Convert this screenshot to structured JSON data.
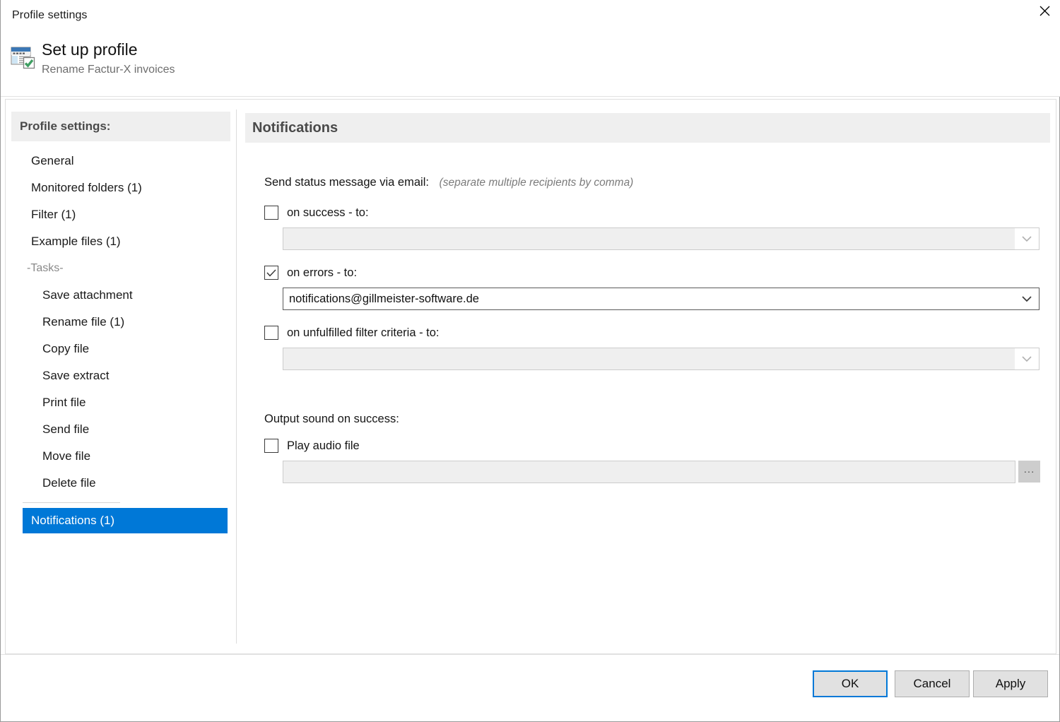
{
  "window": {
    "title": "Profile settings",
    "close_icon": "close-icon"
  },
  "header": {
    "icon": "profile-setup-icon",
    "title": "Set up profile",
    "subtitle": "Rename Factur-X invoices"
  },
  "sidebar": {
    "heading": "Profile settings:",
    "items": [
      {
        "label": "General",
        "kind": "item",
        "selected": false
      },
      {
        "label": "Monitored folders (1)",
        "kind": "item",
        "selected": false
      },
      {
        "label": "Filter (1)",
        "kind": "item",
        "selected": false
      },
      {
        "label": "Example files (1)",
        "kind": "item",
        "selected": false
      },
      {
        "label": "-Tasks-",
        "kind": "section",
        "selected": false
      },
      {
        "label": "Save attachment",
        "kind": "task",
        "selected": false
      },
      {
        "label": "Rename file (1)",
        "kind": "task",
        "selected": false
      },
      {
        "label": "Copy file",
        "kind": "task",
        "selected": false
      },
      {
        "label": "Save extract",
        "kind": "task",
        "selected": false
      },
      {
        "label": "Print file",
        "kind": "task",
        "selected": false
      },
      {
        "label": "Send file",
        "kind": "task",
        "selected": false
      },
      {
        "label": "Move file",
        "kind": "task",
        "selected": false
      },
      {
        "label": "Delete file",
        "kind": "task",
        "selected": false
      },
      {
        "label": "Notifications (1)",
        "kind": "item",
        "selected": true
      }
    ]
  },
  "main": {
    "section_title": "Notifications",
    "email_group": {
      "label": "Send status message via email:",
      "hint": "(separate multiple recipients by comma)",
      "rows": [
        {
          "checkbox_label": "on success - to:",
          "checked": false,
          "value": "",
          "placeholder": "",
          "enabled": false
        },
        {
          "checkbox_label": "on errors - to:",
          "checked": true,
          "value": "notifications@gillmeister-software.de",
          "placeholder": "",
          "enabled": true
        },
        {
          "checkbox_label": "on unfulfilled filter criteria - to:",
          "checked": false,
          "value": "",
          "placeholder": "",
          "enabled": false
        }
      ]
    },
    "sound_group": {
      "label": "Output sound on success:",
      "checkbox_label": "Play audio file",
      "checked": false,
      "value": "",
      "placeholder": "",
      "browse_label": "..."
    }
  },
  "footer": {
    "ok_label": "OK",
    "cancel_label": "Cancel",
    "apply_label": "Apply"
  },
  "colors": {
    "accent": "#0078d7",
    "header_band": "#efefef",
    "disabled_field": "#efefef",
    "check_mark": "#3a3a3a"
  }
}
